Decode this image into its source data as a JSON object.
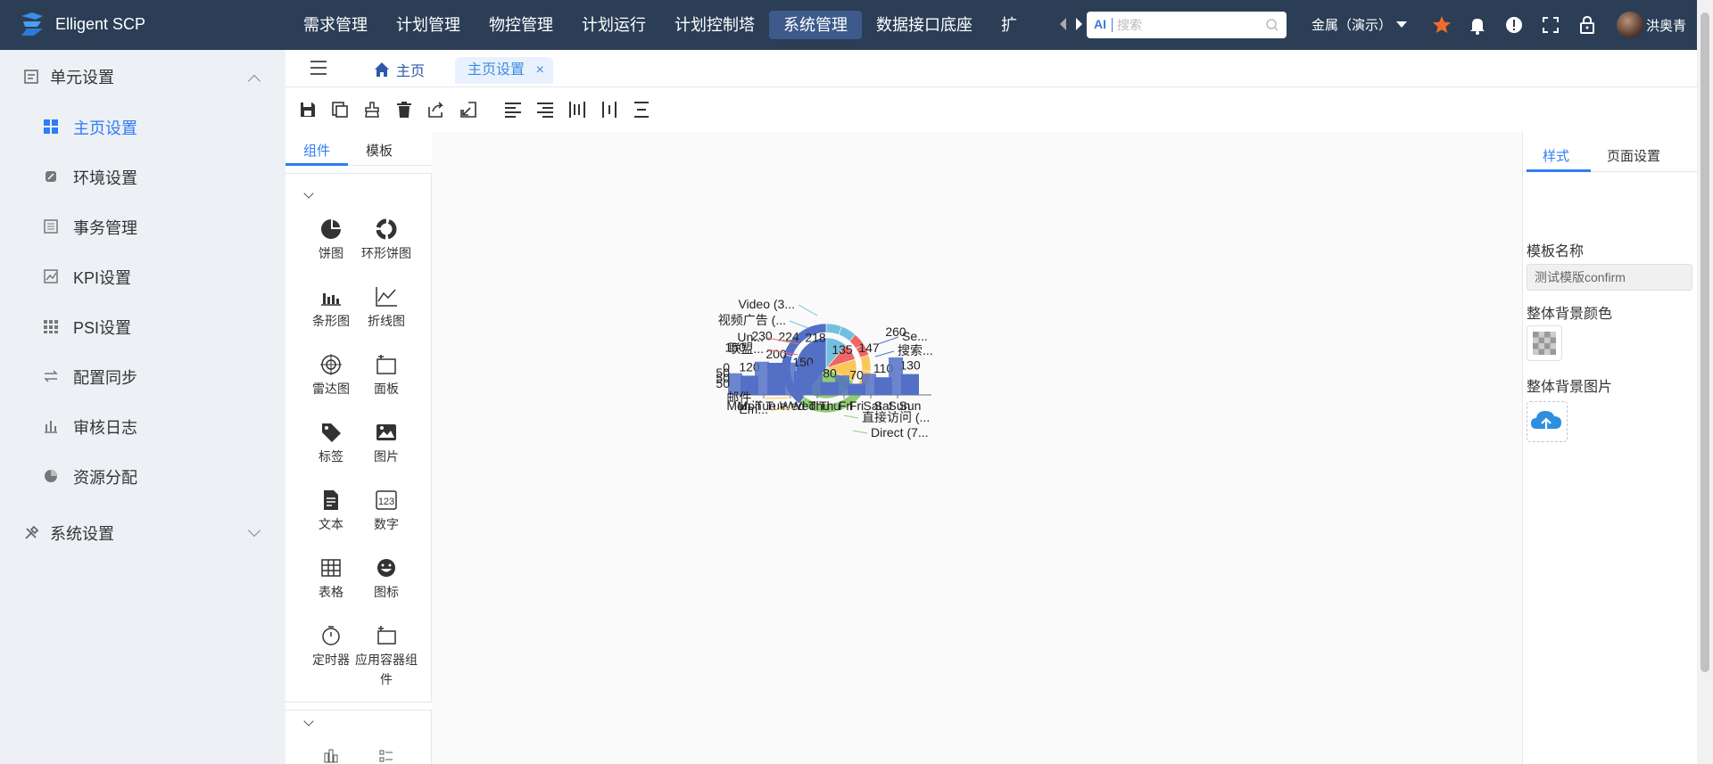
{
  "app": {
    "title": "Elligent SCP"
  },
  "topnav": {
    "items": [
      "需求管理",
      "计划管理",
      "物控管理",
      "计划运行",
      "计划控制塔",
      "系统管理",
      "数据接口底座",
      "扩展"
    ],
    "active_index": 5
  },
  "search": {
    "ai_label": "AI",
    "placeholder": "搜索"
  },
  "header": {
    "company": "金属（演示）",
    "username": "洪奥青"
  },
  "sidebar": {
    "groups": [
      {
        "label": "单元设置",
        "icon": "unit-settings-icon",
        "expanded": true,
        "items": [
          {
            "label": "主页设置",
            "icon": "home-settings-icon",
            "active": true
          },
          {
            "label": "环境设置",
            "icon": "environment-icon"
          },
          {
            "label": "事务管理",
            "icon": "transaction-icon"
          },
          {
            "label": "KPI设置",
            "icon": "kpi-icon"
          },
          {
            "label": "PSI设置",
            "icon": "psi-icon"
          },
          {
            "label": "配置同步",
            "icon": "sync-icon"
          },
          {
            "label": "审核日志",
            "icon": "audit-log-icon"
          },
          {
            "label": "资源分配",
            "icon": "resource-icon"
          }
        ]
      },
      {
        "label": "系统设置",
        "icon": "system-settings-icon",
        "expanded": false
      }
    ]
  },
  "tabs": [
    {
      "label": "主页",
      "icon": "home-icon"
    },
    {
      "label": "主页设置",
      "active": true,
      "closable": true
    }
  ],
  "toolbar": {
    "buttons": [
      "save-icon",
      "copy-icon",
      "clear-icon",
      "delete-icon",
      "export-icon",
      "import-icon",
      "align-left-icon",
      "align-right-icon",
      "distribute-horizontal-icon",
      "align-center-vertical-icon",
      "distribute-vertical-icon"
    ]
  },
  "component_panel": {
    "tabs": [
      "组件",
      "模板"
    ],
    "active_tab": 0,
    "components": [
      {
        "label": "饼图",
        "icon": "pie-chart-icon"
      },
      {
        "label": "环形饼图",
        "icon": "donut-chart-icon"
      },
      {
        "label": "条形图",
        "icon": "bar-chart-icon"
      },
      {
        "label": "折线图",
        "icon": "line-chart-icon"
      },
      {
        "label": "雷达图",
        "icon": "radar-chart-icon"
      },
      {
        "label": "面板",
        "icon": "panel-icon"
      },
      {
        "label": "标签",
        "icon": "tag-icon"
      },
      {
        "label": "图片",
        "icon": "image-icon"
      },
      {
        "label": "文本",
        "icon": "text-icon"
      },
      {
        "label": "数字",
        "icon": "number-icon"
      },
      {
        "label": "表格",
        "icon": "table-icon"
      },
      {
        "label": "图标",
        "icon": "emoji-icon"
      },
      {
        "label": "定时器",
        "icon": "timer-icon"
      },
      {
        "label": "应用容器组件",
        "icon": "app-container-icon"
      }
    ]
  },
  "right_panel": {
    "tabs": [
      "样式",
      "页面设置"
    ],
    "active_tab": 0,
    "template_name_label": "模板名称",
    "template_name_value": "测试模版confirm",
    "bg_color_label": "整体背景颜色",
    "bg_image_label": "整体背景图片"
  },
  "colors": {
    "topbar": "#2b3e56",
    "accent": "#2f7cf6",
    "active_nav": "#3d5a8a"
  },
  "chart_data": [
    {
      "type": "pie",
      "labels": [
        "Video (3...",
        "视频广告 (...",
        "Un...",
        "联盟...",
        "邮件...",
        "Em...",
        "直接访问 (...",
        "Direct (7...",
        "搜索...",
        "Se..."
      ],
      "series": [
        {
          "values": [
            300,
            300,
            234,
            234,
            310,
            310,
            748,
            748,
            1048,
            1048
          ]
        }
      ]
    },
    {
      "type": "bar",
      "categories": [
        "Mon",
        "Tue",
        "Wed",
        "Thu",
        "Fri",
        "Sat",
        "Sun"
      ],
      "series": [
        {
          "values": [
            120,
            200,
            150,
            80,
            70,
            110,
            130
          ]
        }
      ]
    },
    {
      "type": "bar",
      "categories": [
        "Mon",
        "Tue",
        "Wed",
        "Thu",
        "Fri",
        "Sat",
        "Sun"
      ],
      "series": [
        {
          "values": [
            150,
            230,
            224,
            218,
            135,
            147,
            260
          ]
        }
      ]
    }
  ]
}
